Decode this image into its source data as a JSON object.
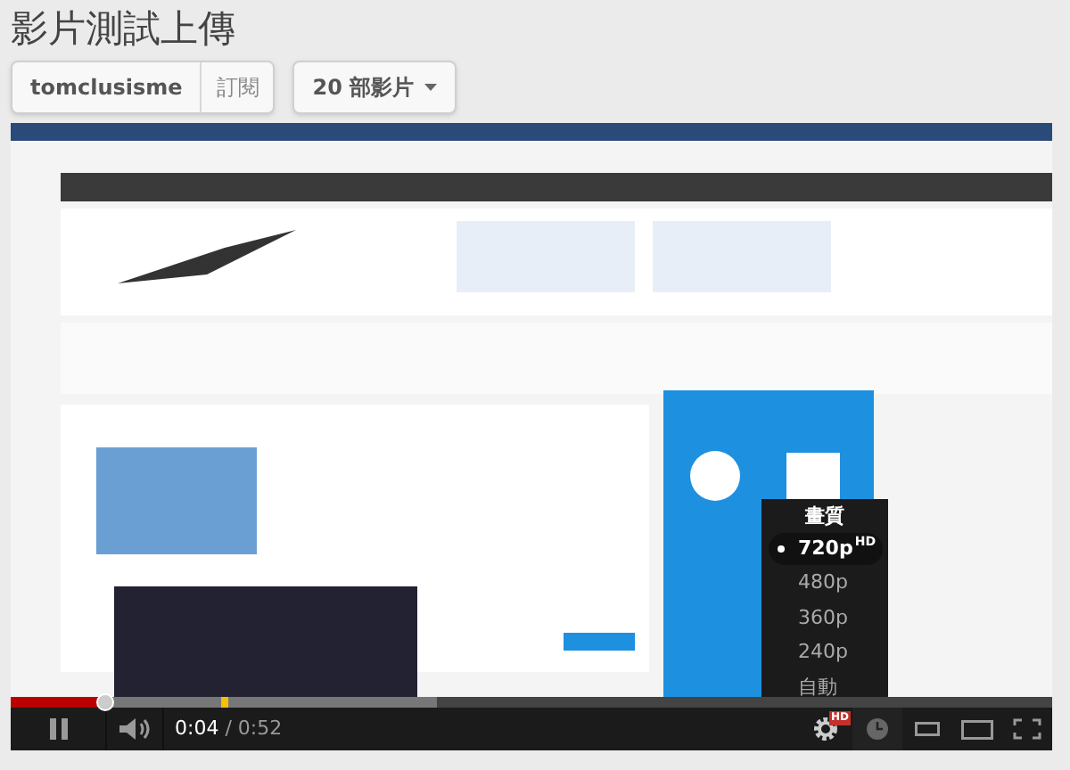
{
  "title": "影片測試上傳",
  "channel": {
    "name": "tomclusisme",
    "subscribe": "訂閱"
  },
  "playlist": {
    "label": "20 部影片"
  },
  "player": {
    "progress": {
      "level": 0.09,
      "buffered": {
        "level": 0.41
      }
    },
    "time": {
      "current": "0:04",
      "separator": "/",
      "total": "0:52"
    },
    "quality_menu": {
      "title": "畫質",
      "items": [
        {
          "label": "720p",
          "badge": "HD",
          "selected": true
        },
        {
          "label": "480p",
          "selected": false
        },
        {
          "label": "360p",
          "selected": false
        },
        {
          "label": "240p",
          "selected": false
        },
        {
          "label": "自動",
          "selected": false
        }
      ]
    },
    "settings_badge": "HD"
  }
}
